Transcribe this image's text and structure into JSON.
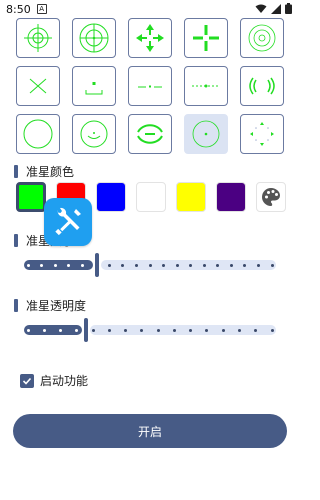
{
  "status_bar": {
    "time": "8:50",
    "indicator": "A"
  },
  "crosshair_grid": {
    "selected_index": 13,
    "tiles": [
      {
        "icon": "crosshair-circle-cross-icon"
      },
      {
        "icon": "crosshair-double-circle-icon"
      },
      {
        "icon": "crosshair-arrows-icon"
      },
      {
        "icon": "crosshair-plus-gap-icon"
      },
      {
        "icon": "crosshair-target-rings-icon"
      },
      {
        "icon": "crosshair-x-icon"
      },
      {
        "icon": "crosshair-bracket-dot-icon"
      },
      {
        "icon": "crosshair-line-dot-icon"
      },
      {
        "icon": "crosshair-dashed-line-icon"
      },
      {
        "icon": "crosshair-side-arcs-icon"
      },
      {
        "icon": "crosshair-plain-circle-icon"
      },
      {
        "icon": "crosshair-circle-arc-icon"
      },
      {
        "icon": "crosshair-split-ellipse-icon"
      },
      {
        "icon": "crosshair-dot-circle-icon"
      },
      {
        "icon": "crosshair-triangle-dots-icon"
      }
    ],
    "crosshair_color": "#22dd22"
  },
  "color_section": {
    "title": "准星颜色",
    "swatches": [
      {
        "color": "#00ff00",
        "selected": true
      },
      {
        "color": "#ff0000",
        "selected": false
      },
      {
        "color": "#0000ff",
        "selected": false
      },
      {
        "color": "#ffffff",
        "selected": false
      },
      {
        "color": "#ffff00",
        "selected": false
      },
      {
        "color": "#4b0082",
        "selected": false
      }
    ],
    "palette_icon": "palette-icon"
  },
  "size_section": {
    "title": "准星大小",
    "value": 0.28,
    "steps": 19
  },
  "opacity_section": {
    "title": "准星透明度",
    "value": 0.24,
    "steps": 16
  },
  "enable_checkbox": {
    "label": "启动功能",
    "checked": true
  },
  "start_button": {
    "label": "开启"
  },
  "overlay": {
    "icon": "wrench-screwdriver-icon",
    "color": "#1f9ff0"
  },
  "theme": {
    "accent": "#475b86",
    "track": "#dfe6f5"
  }
}
